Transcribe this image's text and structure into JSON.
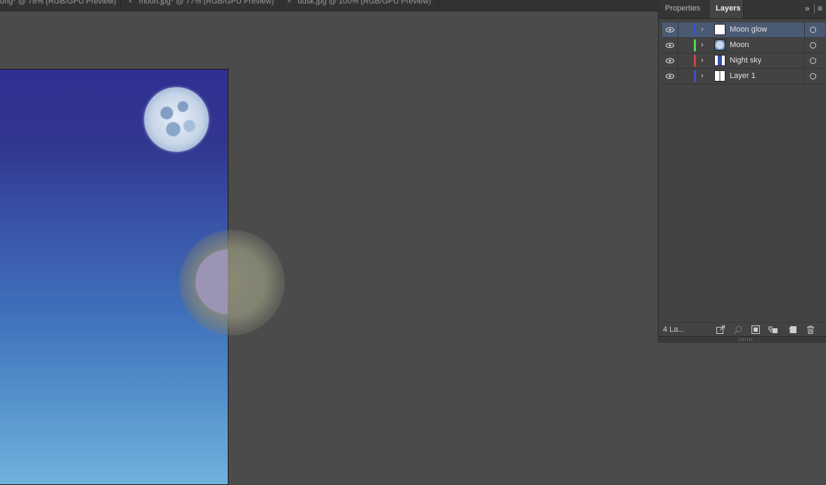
{
  "document_tabs": [
    {
      "label": "ong* @ 78% (RGB/GPU Preview)",
      "close": ""
    },
    {
      "label": "moon.jpg* @ 77% (RGB/GPU Preview)",
      "close": "×"
    },
    {
      "label": "dusk.jpg @ 100% (RGB/GPU Preview)",
      "close": "×"
    }
  ],
  "panel": {
    "tabs": [
      {
        "label": "Properties",
        "active": false
      },
      {
        "label": "Layers",
        "active": true
      }
    ],
    "collapse_glyph": "»",
    "menu_glyph": "≡"
  },
  "layers": [
    {
      "name": "Moon glow",
      "color": "#3f4fd8",
      "selected": true
    },
    {
      "name": "Moon",
      "color": "#4fd84f",
      "selected": false
    },
    {
      "name": "Night sky",
      "color": "#d83f3f",
      "selected": false
    },
    {
      "name": "Layer 1",
      "color": "#3f4fd8",
      "selected": false
    }
  ],
  "footer": {
    "count_label": "4 La...",
    "icons": [
      "export-icon",
      "locate-object-icon",
      "clipping-mask-icon",
      "new-sublayer-icon",
      "new-layer-icon",
      "trash-icon"
    ]
  }
}
